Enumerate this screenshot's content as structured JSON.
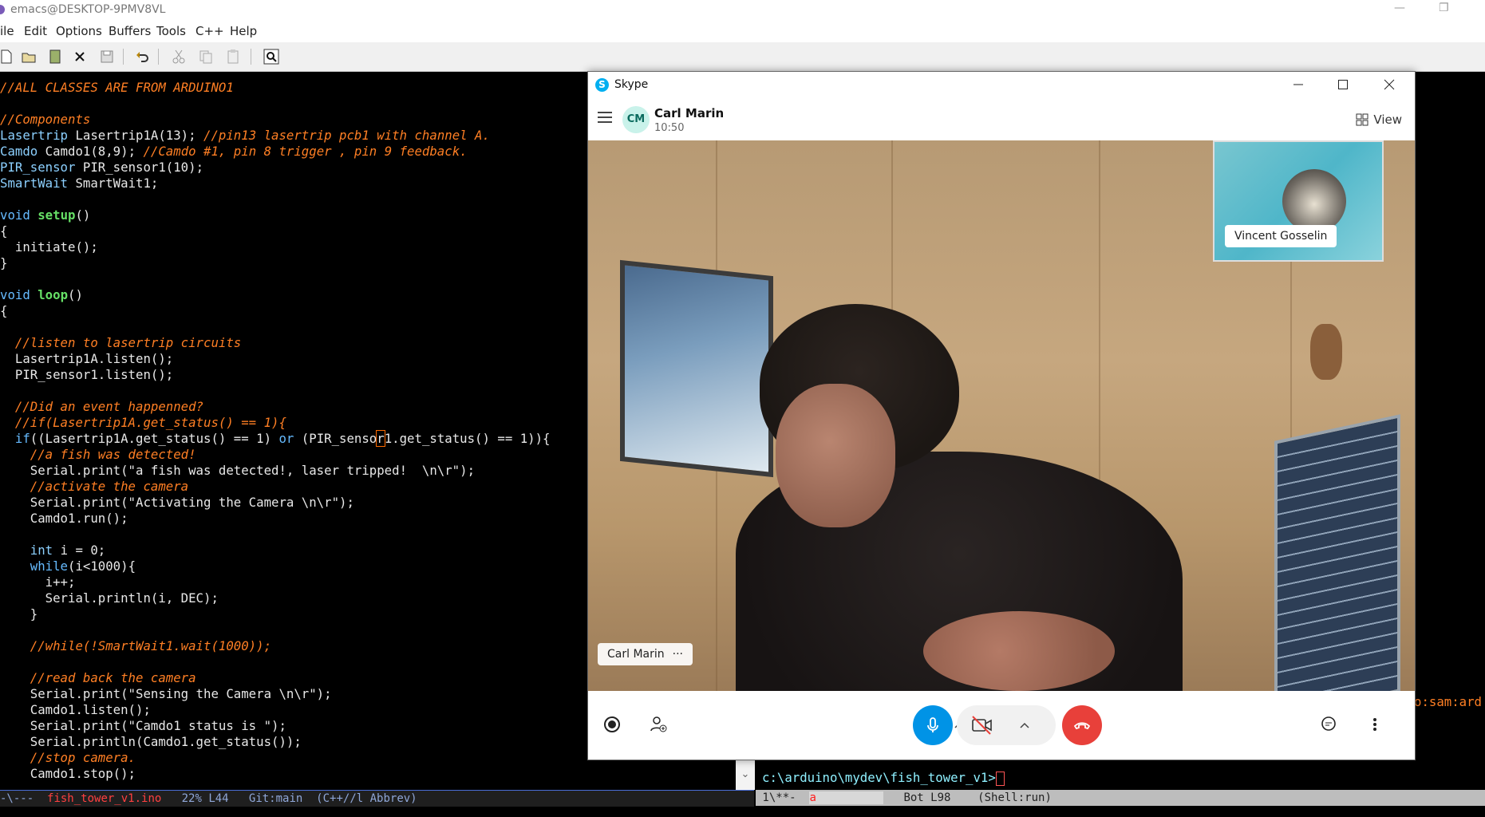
{
  "emacs": {
    "title": "emacs@DESKTOP-9PMV8VL",
    "menu": [
      "ile",
      "Edit",
      "Options",
      "Buffers",
      "Tools",
      "C++",
      "Help"
    ],
    "code_lines": [
      [
        [
          "cm",
          "//ALL CLASSES ARE FROM ARDUINO1"
        ]
      ],
      [],
      [
        [
          "cm",
          "//Components"
        ]
      ],
      [
        [
          "ty",
          "Lasertrip"
        ],
        [
          "tx",
          " Lasertrip1A(13); "
        ],
        [
          "cm",
          "//pin13 lasertrip pcb1 with channel A."
        ]
      ],
      [
        [
          "ty",
          "Camdo"
        ],
        [
          "tx",
          " Camdo1(8,9); "
        ],
        [
          "cm",
          "//Camdo #1, pin 8 trigger , pin 9 feedback."
        ]
      ],
      [
        [
          "ty",
          "PIR_sensor"
        ],
        [
          "tx",
          " PIR_sensor1(10);"
        ]
      ],
      [
        [
          "ty",
          "SmartWait"
        ],
        [
          "tx",
          " SmartWait1;"
        ]
      ],
      [],
      [
        [
          "kw",
          "void"
        ],
        [
          "tx",
          " "
        ],
        [
          "fn",
          "setup"
        ],
        [
          "tx",
          "()"
        ]
      ],
      [
        [
          "tx",
          "{"
        ]
      ],
      [
        [
          "tx",
          "  initiate();"
        ]
      ],
      [
        [
          "tx",
          "}"
        ]
      ],
      [],
      [
        [
          "kw",
          "void"
        ],
        [
          "tx",
          " "
        ],
        [
          "fn",
          "loop"
        ],
        [
          "tx",
          "()"
        ]
      ],
      [
        [
          "tx",
          "{"
        ]
      ],
      [],
      [
        [
          "cm",
          "  //listen to lasertrip circuits"
        ]
      ],
      [
        [
          "tx",
          "  Lasertrip1A.listen();"
        ]
      ],
      [
        [
          "tx",
          "  PIR_sensor1.listen();"
        ]
      ],
      [],
      [
        [
          "cm",
          "  //Did an event happenned?"
        ]
      ],
      [
        [
          "cm",
          "  //if(Lasertrip1A.get_status() == 1){"
        ]
      ],
      [
        [
          "tx",
          "  "
        ],
        [
          "kw",
          "if"
        ],
        [
          "tx",
          "((Lasertrip1A.get_status() == 1) "
        ],
        [
          "kw",
          "or"
        ],
        [
          "tx",
          " (PIR_senso"
        ],
        [
          "cur",
          "r"
        ],
        [
          "tx",
          "1.get_status() == 1)){"
        ]
      ],
      [
        [
          "cm",
          "    //a fish was detected!"
        ]
      ],
      [
        [
          "tx",
          "    Serial.print(\"a fish was detected!, laser tripped!  \\n\\r\");"
        ]
      ],
      [
        [
          "cm",
          "    //activate the camera"
        ]
      ],
      [
        [
          "tx",
          "    Serial.print(\"Activating the Camera \\n\\r\");"
        ]
      ],
      [
        [
          "tx",
          "    Camdo1.run();"
        ]
      ],
      [],
      [
        [
          "tx",
          "    "
        ],
        [
          "ty",
          "int"
        ],
        [
          "tx",
          " i = 0;"
        ]
      ],
      [
        [
          "tx",
          "    "
        ],
        [
          "kw",
          "while"
        ],
        [
          "tx",
          "(i<1000){"
        ]
      ],
      [
        [
          "tx",
          "      i++;"
        ]
      ],
      [
        [
          "tx",
          "      Serial.println(i, DEC);"
        ]
      ],
      [
        [
          "tx",
          "    }"
        ]
      ],
      [],
      [
        [
          "cm",
          "    //while(!SmartWait1.wait(1000));"
        ]
      ],
      [],
      [
        [
          "cm",
          "    //read back the camera"
        ]
      ],
      [
        [
          "tx",
          "    Serial.print(\"Sensing the Camera \\n\\r\");"
        ]
      ],
      [
        [
          "tx",
          "    Camdo1.listen();"
        ]
      ],
      [
        [
          "tx",
          "    Serial.print(\"Camdo1 status is \");"
        ]
      ],
      [
        [
          "tx",
          "    Serial.println(Camdo1.get_status());"
        ]
      ],
      [
        [
          "cm",
          "    //stop camera."
        ]
      ],
      [
        [
          "tx",
          "    Camdo1.stop();"
        ]
      ]
    ],
    "modeline_left": {
      "prefix": "-\\---  ",
      "buffer": "fish_tower_v1.ino",
      "rest": "   22% L44   Git:main  (C++//l Abbrev)"
    },
    "modeline_right": {
      "prefix": " 1\\**-  ",
      "buffer": "a          ",
      "rest": "   Bot L98    (Shell:run)"
    },
    "shell_prompt": "c:\\arduino\\mydev\\fish_tower_v1>",
    "shell_right_fragment": "o:sam:ard"
  },
  "skype": {
    "title": "Skype",
    "contact_initials": "CM",
    "contact_name": "Carl Marin",
    "call_time": "10:50",
    "view_label": "View",
    "self_name": "Vincent Gosselin",
    "caller_label": "Carl Marin",
    "caller_more": "···",
    "colors": {
      "mic": "#0093e6",
      "end_call": "#e8403a",
      "avatar_bg": "#c9f2ea"
    }
  }
}
